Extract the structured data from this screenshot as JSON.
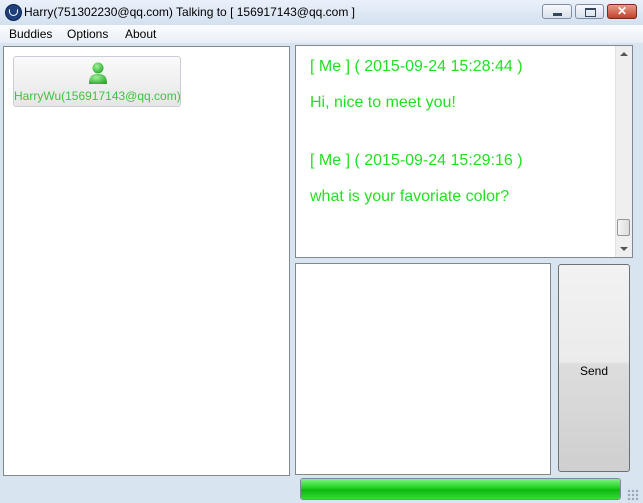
{
  "window": {
    "title": "Harry(751302230@qq.com) Talking to [ 156917143@qq.com ]",
    "close_label": "✕"
  },
  "menu": {
    "items": [
      "Buddies",
      "Options",
      "About"
    ]
  },
  "buddies": [
    {
      "label": "HarryWu(156917143@qq.com)",
      "icon": "person-icon"
    }
  ],
  "chat": {
    "messages": [
      {
        "header": "[ Me ] ( 2015-09-24 15:28:44 )",
        "text": "Hi, nice to meet you!"
      },
      {
        "header": "[ Me ] ( 2015-09-24 15:29:16 )",
        "text": "what is your favoriate color?"
      }
    ]
  },
  "input": {
    "value": ""
  },
  "send_button": {
    "label": "Send"
  },
  "progress": {
    "value": 1.0
  },
  "colors": {
    "message_green": "#22e022",
    "buddy_green": "#3fc33f",
    "progress_green": "#1fd21f"
  }
}
